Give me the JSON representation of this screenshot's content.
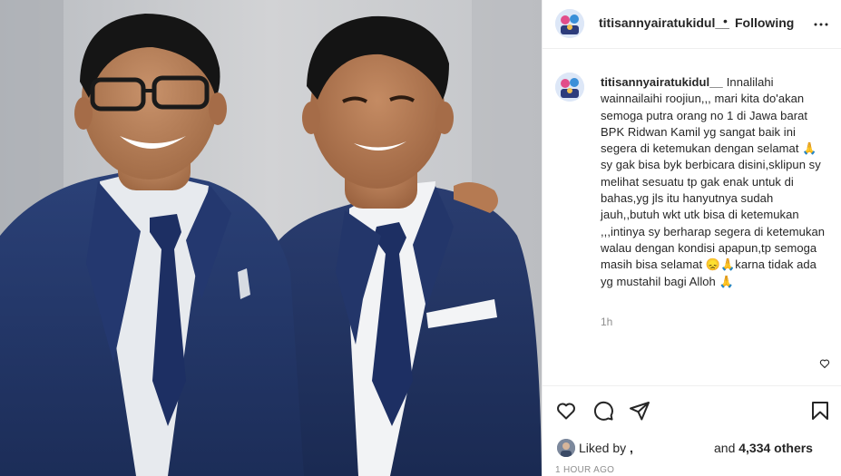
{
  "post": {
    "username": "titisannyairatukidul__",
    "follow_status": "Following",
    "separator": "•",
    "caption": "Innalilahi wainnailaihi roojiun,,, mari kita do'akan semoga putra orang no 1 di Jawa barat BPK Ridwan Kamil yg sangat baik ini segera di ketemukan dengan selamat 🙏 sy gak bisa byk berbicara disini,sklipun sy melihat sesuatu tp gak enak untuk di bahas,yg jls itu hanyutnya sudah jauh,,butuh wkt utk bisa di ketemukan ,,,intinya sy berharap segera di ketemukan walau dengan kondisi apapun,tp semoga masih bisa selamat 😞🙏karna tidak ada yg mustahil bagi Alloh 🙏",
    "relative_time": "1h",
    "liked_by_label": "Liked by",
    "liked_by_user": ",",
    "and_label": "and",
    "likes_count": "4,334 others",
    "timestamp": "1 HOUR AGO"
  },
  "icons": {
    "more": "more-horizontal-icon",
    "like": "heart-icon",
    "comment": "comment-icon",
    "share": "send-icon",
    "save": "bookmark-icon",
    "caption_like": "small-heart-icon"
  },
  "colors": {
    "text": "#262626",
    "muted": "#8e8e8e",
    "divider": "#efefef",
    "suit": "#1f3463"
  }
}
